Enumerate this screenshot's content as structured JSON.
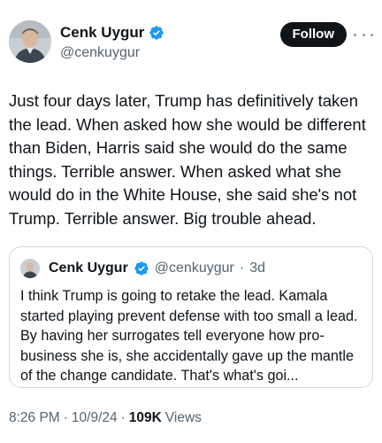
{
  "author": {
    "display_name": "Cenk Uygur",
    "handle": "@cenkuygur"
  },
  "actions": {
    "follow_label": "Follow"
  },
  "tweet": {
    "text": "Just four days later, Trump has definitively taken the lead. When asked how she would be different than Biden, Harris said she would do the same things. Terrible answer. When asked what she would do in the White House, she said she's not Trump. Terrible answer. Big trouble ahead."
  },
  "quoted_tweet": {
    "display_name": "Cenk Uygur",
    "handle": "@cenkuygur",
    "separator": "·",
    "age": "3d",
    "text": "I think Trump is going to retake the lead. Kamala started playing prevent defense with too small a lead. By having her surrogates tell everyone how pro-business she is, she accidentally gave up the mantle of the change candidate. That's what's goi..."
  },
  "meta": {
    "time": "8:26 PM",
    "separator": "·",
    "date": "10/9/24",
    "views_count": "109K",
    "views_label": "Views"
  },
  "colors": {
    "verified": "#1d9bf0",
    "follow_bg": "#0f1419",
    "secondary_text": "#536471"
  },
  "icons": {
    "verified": "verified-badge-icon",
    "more": "more-dots-icon"
  }
}
